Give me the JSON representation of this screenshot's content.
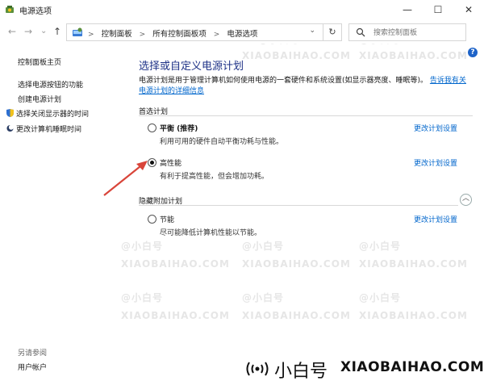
{
  "window": {
    "title": "电源选项",
    "minimize": "—",
    "maximize": "☐",
    "close": "✕"
  },
  "nav": {
    "back": "←",
    "forward": "→",
    "recent": "⌄",
    "up": "↑"
  },
  "address": {
    "crumbs": [
      "控制面板",
      "所有控制面板项",
      "电源选项"
    ],
    "separator": ">",
    "dropdown": "⌄",
    "refresh": "↻"
  },
  "search": {
    "placeholder": "搜索控制面板"
  },
  "sidebar": {
    "home": "控制面板主页",
    "items": [
      "选择电源按钮的功能",
      "创建电源计划",
      "选择关闭显示器的时间",
      "更改计算机睡眠时间"
    ],
    "see_also": "另请参阅",
    "user_accounts": "用户帐户"
  },
  "main": {
    "heading": "选择或自定义电源计划",
    "description": "电源计划是用于管理计算机如何使用电源的一套硬件和系统设置(如显示器亮度、睡眠等)。",
    "description_link": "告诉我有关电源计划的详细信息",
    "preferred_label": "首选计划",
    "hidden_label": "隐藏附加计划",
    "collapse": "︿",
    "change_link": "更改计划设置",
    "plans": [
      {
        "name": "平衡 (推荐)",
        "desc": "利用可用的硬件自动平衡功耗与性能。",
        "selected": false
      },
      {
        "name": "高性能",
        "desc": "有利于提高性能，但会增加功耗。",
        "selected": true
      },
      {
        "name": "节能",
        "desc": "尽可能降低计算机性能以节能。",
        "selected": false
      }
    ]
  },
  "watermark": {
    "cn": "小白号",
    "url": "XIAOBAIHAO.COM",
    "faint_cn": "@小白号",
    "faint_url": "XIAOBAIHAO.COM"
  },
  "colors": {
    "heading": "#1e3287",
    "link": "#0066cc",
    "arrow": "#d9453a",
    "help": "#1e63c8"
  }
}
